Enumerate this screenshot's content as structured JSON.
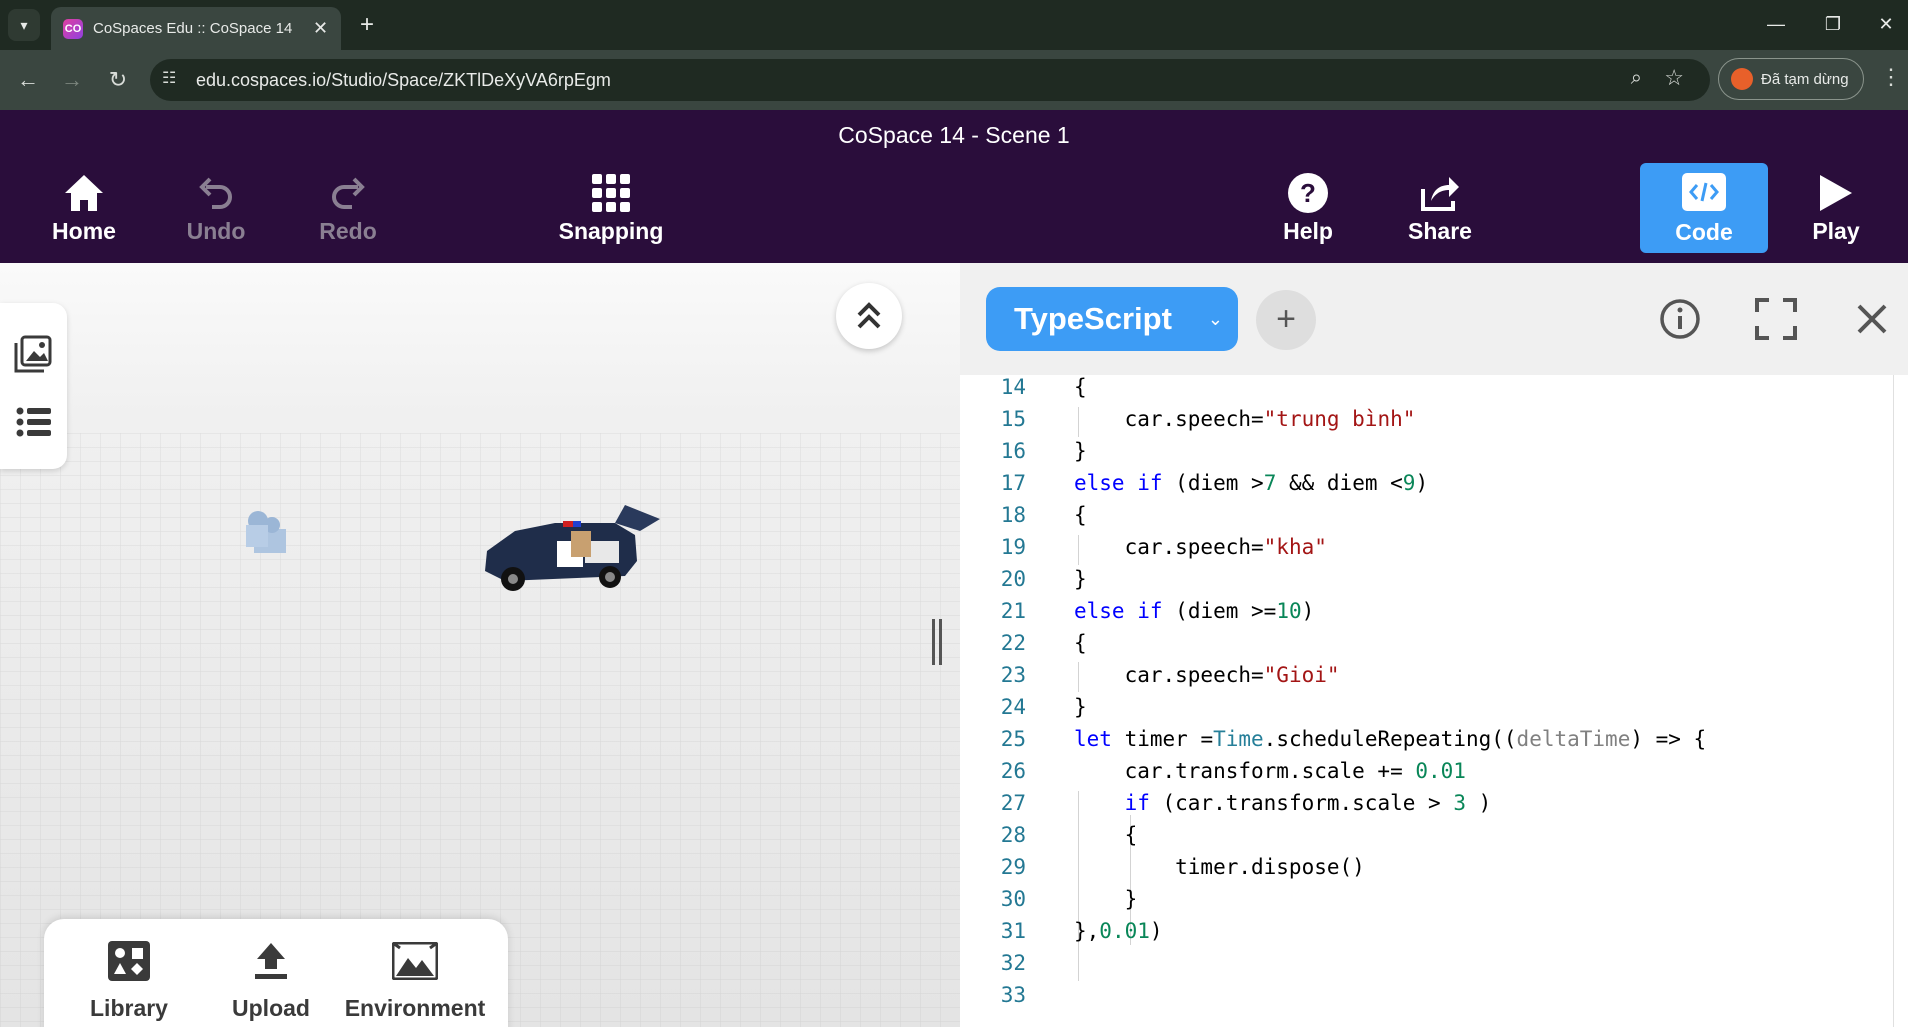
{
  "browser": {
    "tab_title": "CoSpaces Edu :: CoSpace 14",
    "favicon_text": "CO",
    "url": "edu.cospaces.io/Studio/Space/ZKTlDeXyVA6rpEgm",
    "profile_label": "Đã tạm dừng"
  },
  "app": {
    "scene_title": "CoSpace 14 - Scene 1",
    "toolbar": {
      "home": "Home",
      "undo": "Undo",
      "redo": "Redo",
      "snapping": "Snapping",
      "help": "Help",
      "share": "Share",
      "code": "Code",
      "play": "Play"
    },
    "bottom_panel": {
      "library": "Library",
      "upload": "Upload",
      "environment": "Environment"
    }
  },
  "code_editor": {
    "language": "TypeScript",
    "line_numbers": [
      "14",
      "15",
      "16",
      "17",
      "18",
      "19",
      "20",
      "21",
      "22",
      "23",
      "24",
      "25",
      "26",
      "27",
      "28",
      "29",
      "30",
      "31",
      "32",
      "33"
    ]
  },
  "colors": {
    "header_bg": "#2a0d3b",
    "accent_blue": "#3d9cf5",
    "keyword": "#0000ff",
    "string": "#a31515",
    "number": "#098658"
  }
}
